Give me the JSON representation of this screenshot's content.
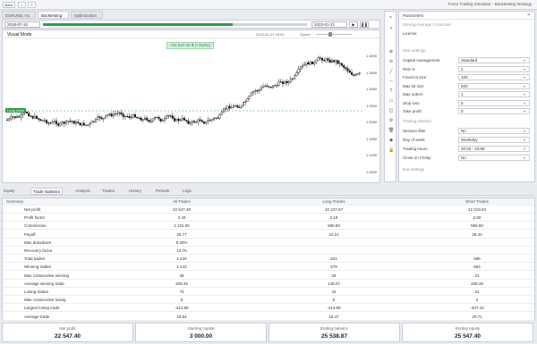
{
  "topbar": {
    "back_label": "Back",
    "title": "Forex Trading Simulator - Backtesting Strategy"
  },
  "tabs": [
    {
      "label": "EURUSD, H1"
    },
    {
      "label": "Backtesting"
    },
    {
      "label": "Optimization"
    }
  ],
  "datebar": {
    "start_date": "2018-07-10",
    "end_date": "2023-01-21",
    "progress": 0.72
  },
  "chart": {
    "title": "Visual Mode",
    "timestamp": "2023-01-21 00:00",
    "speed_label": "Speed",
    "pnl_badge": "+22 547.40 $ (+752%)",
    "entry_label": "Long entry",
    "price_labels": [
      "1.4000",
      "1.3500",
      "1.3000",
      "1.2500",
      "1.2000",
      "1.1500",
      "1.1000",
      "1.0500"
    ],
    "accent": "#2e9e48"
  },
  "tools": [
    "cursor-icon",
    "crosshair-icon",
    "zoom-in-icon",
    "zoom-out-icon",
    "line-icon",
    "hline-icon",
    "text-icon",
    "ruler-icon",
    "eraser-icon",
    "gear-icon",
    "trash-icon",
    "camera-icon",
    "lock-icon"
  ],
  "params": {
    "header": "Parameters",
    "subheader": "Moving Average Crossover",
    "license_label": "License",
    "risk_section": "Risk settings",
    "rows": [
      {
        "label": "Capital management",
        "value": "Standard"
      },
      {
        "label": "Risk %",
        "value": "2"
      },
      {
        "label": "Fixed lot size",
        "value": "100"
      },
      {
        "label": "Max lot size",
        "value": "500"
      },
      {
        "label": "Max orders",
        "value": "1"
      },
      {
        "label": "Stop loss",
        "value": "0"
      },
      {
        "label": "Take profit",
        "value": "0"
      }
    ],
    "session_section": "Trading session",
    "session_rows": [
      {
        "label": "Session filter",
        "value": "No"
      },
      {
        "label": "Day of week",
        "value": "Weekday"
      },
      {
        "label": "Trading hours",
        "value": "00:00 - 23:59"
      },
      {
        "label": "Close on Friday",
        "value": "No"
      }
    ],
    "other_section": "Exit settings"
  },
  "bottom_tabs": [
    {
      "label": "Equity"
    },
    {
      "label": "Trade statistics"
    },
    {
      "label": "Analysis"
    },
    {
      "label": "Trades"
    },
    {
      "label": "History"
    },
    {
      "label": "Periods"
    },
    {
      "label": "Logs"
    }
  ],
  "table": {
    "headers": [
      "Summary",
      "All Trades",
      "Long Trades",
      "Short Trades"
    ],
    "rows": [
      [
        "Net profit",
        "22 547.40",
        "10 227.57",
        "12 319.83"
      ],
      [
        "Profit factor",
        "2.40",
        "2.19",
        "2.60"
      ],
      [
        "Commission",
        "1 131.00",
        "565.50",
        "565.50"
      ],
      [
        "Payoff",
        "26.77",
        "24.21",
        "29.43"
      ],
      [
        "Max drawdown",
        "9.30%",
        "",
        ""
      ],
      [
        "Recovery factor",
        "12.75",
        "",
        ""
      ],
      [
        "Total trades",
        "1 216",
        "621",
        "595"
      ],
      [
        "Winning trades",
        "1 143",
        "579",
        "564"
      ],
      [
        "Max consecutive winning",
        "48",
        "29",
        "31"
      ],
      [
        "Average winning trade",
        "208.49",
        "148.07",
        "208.49"
      ],
      [
        "Losing trades",
        "73",
        "42",
        "31"
      ],
      [
        "Max consecutive losing",
        "5",
        "5",
        "4"
      ],
      [
        "Largest losing trade",
        "-414.85",
        "-414.85",
        "-407.10"
      ],
      [
        "Average trade",
        "18.54",
        "16.47",
        "20.71"
      ]
    ]
  },
  "summary": [
    {
      "label": "Net profit",
      "value": "22 547.40"
    },
    {
      "label": "Starting capital",
      "value": "3 000.00"
    },
    {
      "label": "Ending balance",
      "value": "25 538.87"
    },
    {
      "label": "Ending equity",
      "value": "25 547.40"
    }
  ]
}
